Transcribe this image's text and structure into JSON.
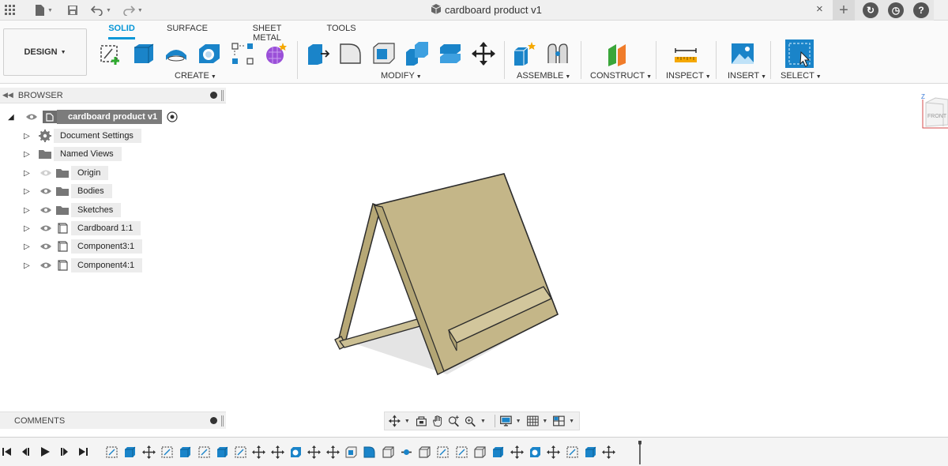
{
  "titlebar": {
    "document_title": "cardboard product v1",
    "close_glyph": "×",
    "plus_glyph": "+",
    "icons": [
      "grid-icon",
      "file-icon",
      "save-icon",
      "undo-icon",
      "redo-icon",
      "cube-icon",
      "close-icon",
      "plus-icon",
      "job-status-icon",
      "clock-icon",
      "help-icon"
    ]
  },
  "toolbar": {
    "workspace": "DESIGN",
    "tabs": [
      "SOLID",
      "SURFACE",
      "SHEET METAL",
      "TOOLS"
    ],
    "active_tab": "SOLID",
    "groups": {
      "create": "CREATE",
      "modify": "MODIFY",
      "assemble": "ASSEMBLE",
      "construct": "CONSTRUCT",
      "inspect": "INSPECT",
      "insert": "INSERT",
      "select": "SELECT"
    },
    "accent_color": "#0696d7"
  },
  "browser": {
    "title": "BROWSER",
    "root": "cardboard product v1",
    "items": [
      {
        "label": "Document Settings",
        "icon": "gear-icon"
      },
      {
        "label": "Named Views",
        "icon": "folder-icon"
      },
      {
        "label": "Origin",
        "icon": "folder-icon"
      },
      {
        "label": "Bodies",
        "icon": "folder-icon"
      },
      {
        "label": "Sketches",
        "icon": "folder-icon"
      },
      {
        "label": "Cardboard 1:1",
        "icon": "component-icon"
      },
      {
        "label": "Component3:1",
        "icon": "component-icon"
      },
      {
        "label": "Component4:1",
        "icon": "component-icon"
      }
    ]
  },
  "comments": {
    "title": "COMMENTS"
  },
  "viewcube": {
    "face_label": "FRONT",
    "axis_label": "Z"
  },
  "model": {
    "face_color": "#c4b688",
    "edge_color": "#2b2b2b"
  }
}
